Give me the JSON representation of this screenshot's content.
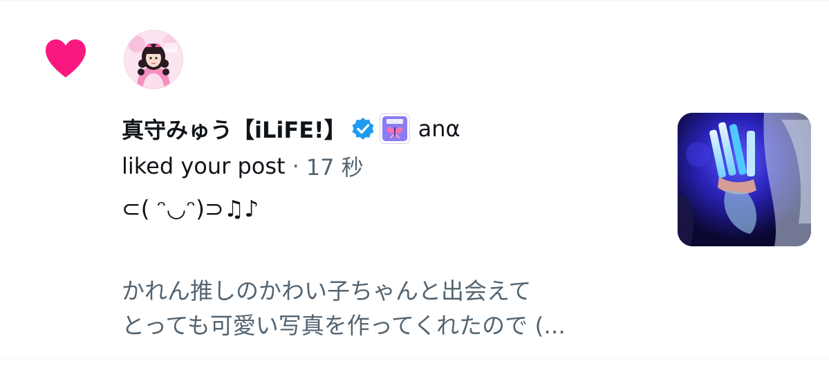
{
  "notification": {
    "user": {
      "display_name": "真守みゅう【iLiFE!】",
      "trailing_name": "anα"
    },
    "action_text": "liked your post",
    "separator": "·",
    "timestamp": "17 秒",
    "post": {
      "kaomoji": "⊂(  ᵔ◡ᵔ)⊃♫♪",
      "line1": "かれん推しのかわい子ちゃんと出会えて",
      "line2": "とっても可愛い写真を作ってくれたので (..."
    }
  },
  "icons": {
    "like": "heart-icon",
    "verified": "verified-badge-icon",
    "affiliate": "affiliate-badge-icon"
  },
  "colors": {
    "like_pink": "#f91880",
    "verified_blue": "#1d9bf0",
    "primary_text": "#0f1419",
    "secondary_text": "#536471"
  }
}
